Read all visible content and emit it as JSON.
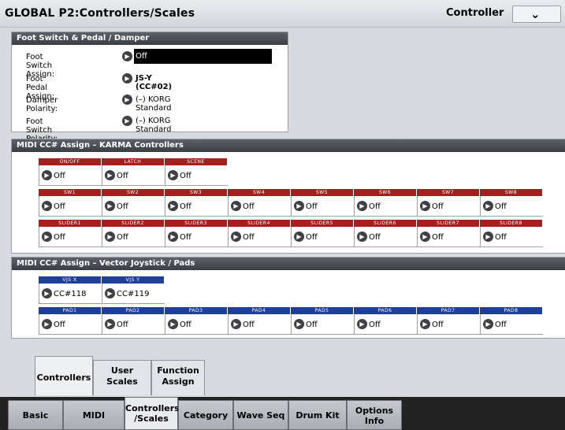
{
  "title": "GLOBAL P2:Controllers/Scales",
  "mode_label": "Controller",
  "foot_section": {
    "heading": "Foot Switch & Pedal / Damper",
    "rows": [
      {
        "label": "Foot Switch Assign:",
        "value": "Off"
      },
      {
        "label": "Foot Pedal Assign:",
        "value": "JS-Y (CC#02)"
      },
      {
        "label": "Damper Polarity:",
        "value": "(–) KORG Standard"
      },
      {
        "label": "Foot Switch Polarity:",
        "value": "(–) KORG Standard"
      }
    ]
  },
  "karma_section": {
    "heading": "MIDI CC# Assign – KARMA Controllers",
    "top_headers": [
      "ON/OFF",
      "LATCH",
      "SCENE"
    ],
    "top_values": [
      "Off",
      "Off",
      "Off"
    ],
    "sw_headers": [
      "SW1",
      "SW2",
      "SW3",
      "SW4",
      "SW5",
      "SW6",
      "SW7",
      "SW8"
    ],
    "sw_values": [
      "Off",
      "Off",
      "Off",
      "Off",
      "Off",
      "Off",
      "Off",
      "Off"
    ],
    "slider_headers": [
      "SLIDER1",
      "SLIDER2",
      "SLIDER3",
      "SLIDER4",
      "SLIDER5",
      "SLIDER6",
      "SLIDER7",
      "SLIDER8"
    ],
    "slider_values": [
      "Off",
      "Off",
      "Off",
      "Off",
      "Off",
      "Off",
      "Off",
      "Off"
    ]
  },
  "vector_section": {
    "heading": "MIDI CC# Assign – Vector Joystick / Pads",
    "vjs_headers": [
      "VJS X",
      "VJS Y"
    ],
    "vjs_values": [
      "CC#118",
      "CC#119"
    ],
    "pad_headers": [
      "PAD1",
      "PAD2",
      "PAD3",
      "PAD4",
      "PAD5",
      "PAD6",
      "PAD7",
      "PAD8"
    ],
    "pad_values": [
      "Off",
      "Off",
      "Off",
      "Off",
      "Off",
      "Off",
      "Off",
      "Off"
    ]
  },
  "sub_tabs": [
    "Controllers",
    "User\nScales",
    "Function\nAssign"
  ],
  "page_tabs": [
    "Basic",
    "MIDI",
    "Controllers\n/Scales",
    "Category",
    "Wave Seq",
    "Drum Kit",
    "Options\nInfo"
  ],
  "colors": {
    "header_red": "#a81d1d",
    "header_blue": "#1f3f99"
  }
}
